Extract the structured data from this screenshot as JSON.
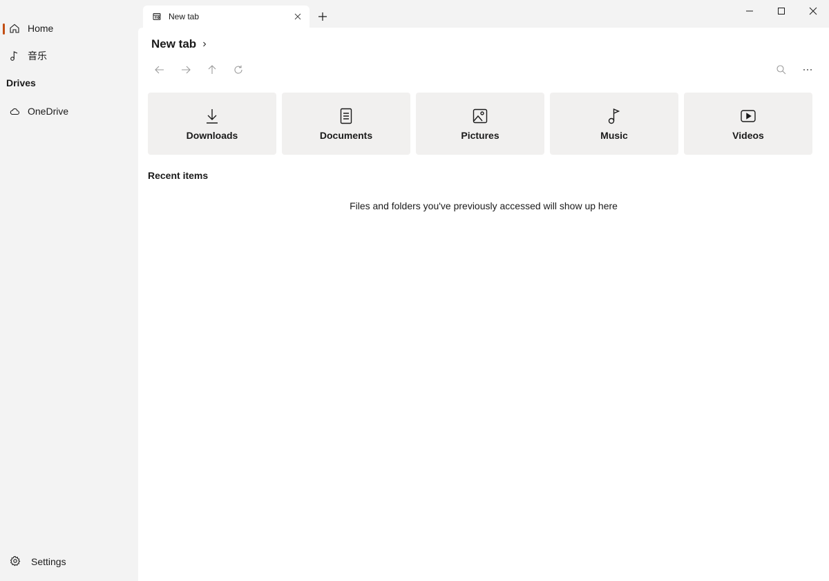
{
  "sidebar": {
    "items": [
      {
        "label": "Home",
        "icon": "home-icon"
      },
      {
        "label": "音乐",
        "icon": "music-note-icon"
      }
    ],
    "drives_label": "Drives",
    "drives": [
      {
        "label": "OneDrive",
        "icon": "cloud-icon"
      }
    ],
    "settings_label": "Settings",
    "accent_color": "#c24e13"
  },
  "tabs": [
    {
      "label": "New tab",
      "icon": "tab-page-icon"
    }
  ],
  "header": {
    "breadcrumb": "New tab"
  },
  "quick_access": [
    {
      "label": "Downloads",
      "icon": "download-icon"
    },
    {
      "label": "Documents",
      "icon": "document-icon"
    },
    {
      "label": "Pictures",
      "icon": "picture-icon"
    },
    {
      "label": "Music",
      "icon": "music-icon"
    },
    {
      "label": "Videos",
      "icon": "video-icon"
    }
  ],
  "recent": {
    "title": "Recent items",
    "empty_message": "Files and folders you've previously accessed will show up here"
  }
}
